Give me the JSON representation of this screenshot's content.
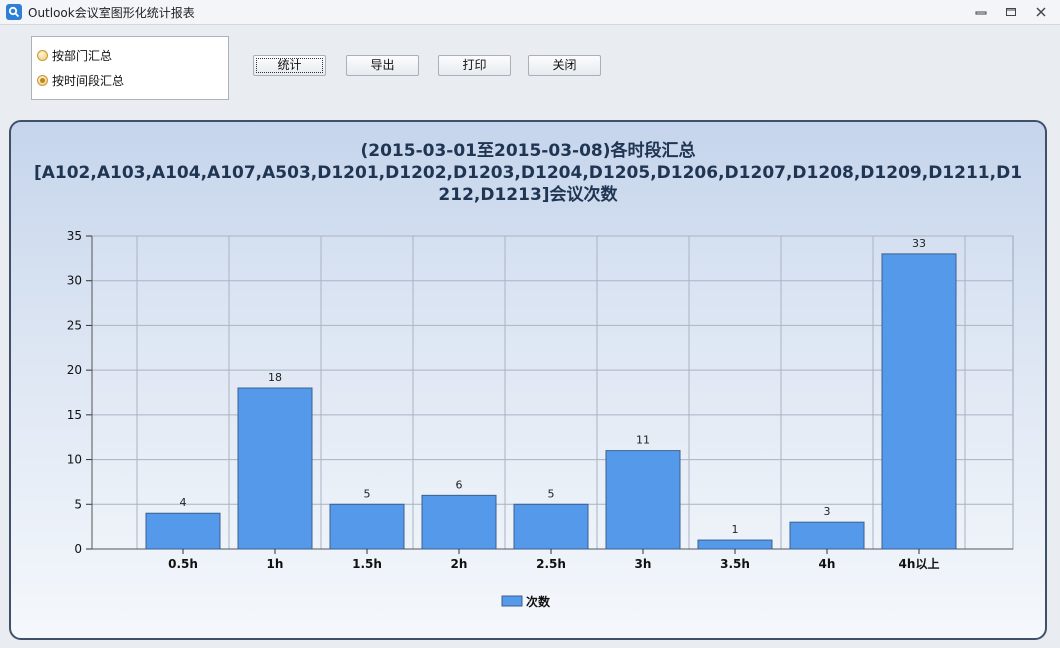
{
  "window": {
    "title": "Outlook会议室图形化统计报表",
    "controls": [
      "minimize-icon",
      "maximize-icon",
      "close-icon"
    ]
  },
  "options": {
    "items": [
      {
        "label": "按部门汇总",
        "checked": false
      },
      {
        "label": "按时间段汇总",
        "checked": true
      }
    ]
  },
  "toolbar": {
    "stat_label": "统计",
    "export_label": "导出",
    "print_label": "打印",
    "close_label": "关闭"
  },
  "colors": {
    "bar": "#5599ea",
    "title": "#1f3552"
  },
  "chart_data": {
    "type": "bar",
    "title_line1": "(2015-03-01至2015-03-08)各时段汇总",
    "title_line2": "[A102,A103,A104,A107,A503,D1201,D1202,D1203,D1204,D1205,D1206,D1207,D1208,D1209,D1211,D1",
    "title_line3": "212,D1213]会议次数",
    "categories": [
      "0.5h",
      "1h",
      "1.5h",
      "2h",
      "2.5h",
      "3h",
      "3.5h",
      "4h",
      "4h以上"
    ],
    "series": [
      {
        "name": "次数",
        "values": [
          4,
          18,
          5,
          6,
          5,
          11,
          1,
          3,
          33
        ]
      }
    ],
    "ylim": [
      0,
      35
    ],
    "yticks": [
      0,
      5,
      10,
      15,
      20,
      25,
      30,
      35
    ],
    "grid": true,
    "legend": "bottom-center"
  }
}
